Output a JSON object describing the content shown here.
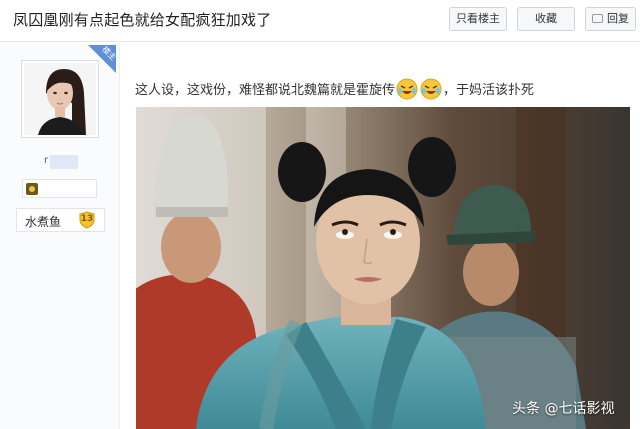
{
  "post": {
    "title": "凤囚凰刚有点起色就给女配疯狂加戏了",
    "body_before": "这人设，这戏份，难怪都说北魏篇就是霍旋传",
    "body_after": "，于妈活该扑死"
  },
  "toolbar": {
    "only_louzhu_label": "只看楼主",
    "favorite_label": "收藏",
    "reply_label": "回复"
  },
  "author": {
    "badge_label": "楼主",
    "name_visible": "r",
    "forum_name": "水煮鱼",
    "level": "13"
  },
  "watermark": "头条 @七话影视",
  "colors": {
    "accent_blue": "#5e8fd8",
    "link_blue": "#2d64b3",
    "level_gold": "#f2c230"
  },
  "icons": {
    "reply": "reply-icon",
    "emoji": "crying-laughing-emoji",
    "level": "level-shield-icon"
  }
}
